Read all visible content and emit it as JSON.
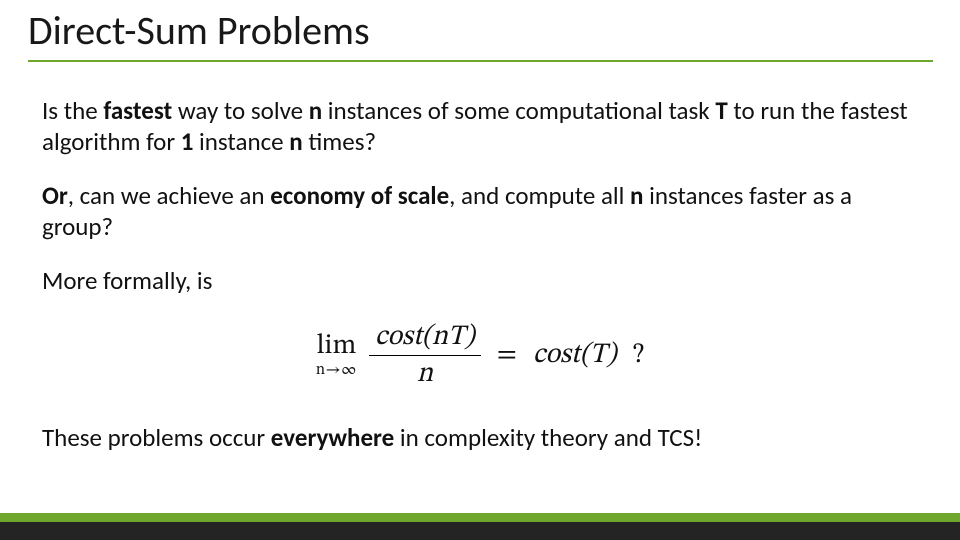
{
  "title": "Direct-Sum Problems",
  "para1": {
    "t1": "Is the ",
    "b1": "fastest",
    "t2": " way to solve ",
    "b2": "n",
    "t3": " instances of some computational task ",
    "b3": "T",
    "t4": " to run the fastest algorithm for ",
    "b4": "1",
    "t5": " instance ",
    "b5": "n",
    "t6": " times?"
  },
  "para2": {
    "b1": "Or",
    "t1": ", can we achieve an ",
    "b2": "economy of scale",
    "t2": ", and compute all ",
    "b3": "n",
    "t3": " instances faster as a group?"
  },
  "more_formally": "More formally, is",
  "equation": {
    "lim": "lim",
    "lim_sub": "n→∞",
    "frac_num": "cost(nT)",
    "frac_den": "n",
    "eq": "=",
    "rhs": "cost(T)",
    "qmark": " ?"
  },
  "closing": {
    "t1": "These problems occur ",
    "b1": "everywhere",
    "t2": " in complexity theory and TCS!"
  },
  "colors": {
    "accent": "#6ea62e",
    "dark": "#242424"
  }
}
